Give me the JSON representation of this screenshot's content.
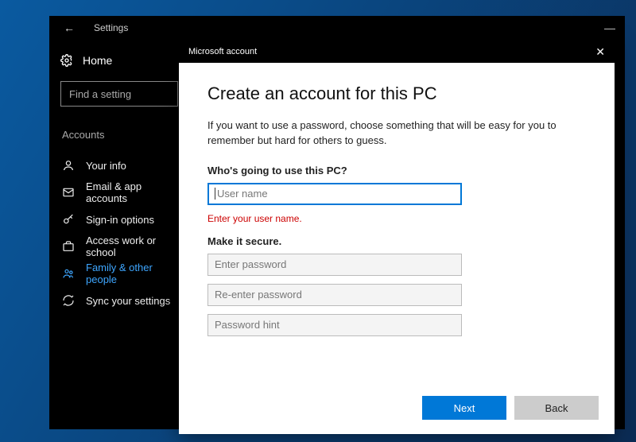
{
  "settings": {
    "title": "Settings",
    "home": "Home",
    "search_placeholder": "Find a setting",
    "section": "Accounts",
    "nav": [
      {
        "label": "Your info"
      },
      {
        "label": "Email & app accounts"
      },
      {
        "label": "Sign-in options"
      },
      {
        "label": "Access work or school"
      },
      {
        "label": "Family & other people"
      },
      {
        "label": "Sync your settings"
      }
    ]
  },
  "dialog": {
    "titlebar": "Microsoft account",
    "heading": "Create an account for this PC",
    "intro": "If you want to use a password, choose something that will be easy for you to remember but hard for others to guess.",
    "q1_label": "Who's going to use this PC?",
    "username_placeholder": "User name",
    "error": "Enter your user name.",
    "q2_label": "Make it secure.",
    "password_placeholder": "Enter password",
    "reenter_placeholder": "Re-enter password",
    "hint_placeholder": "Password hint",
    "next": "Next",
    "back": "Back"
  }
}
